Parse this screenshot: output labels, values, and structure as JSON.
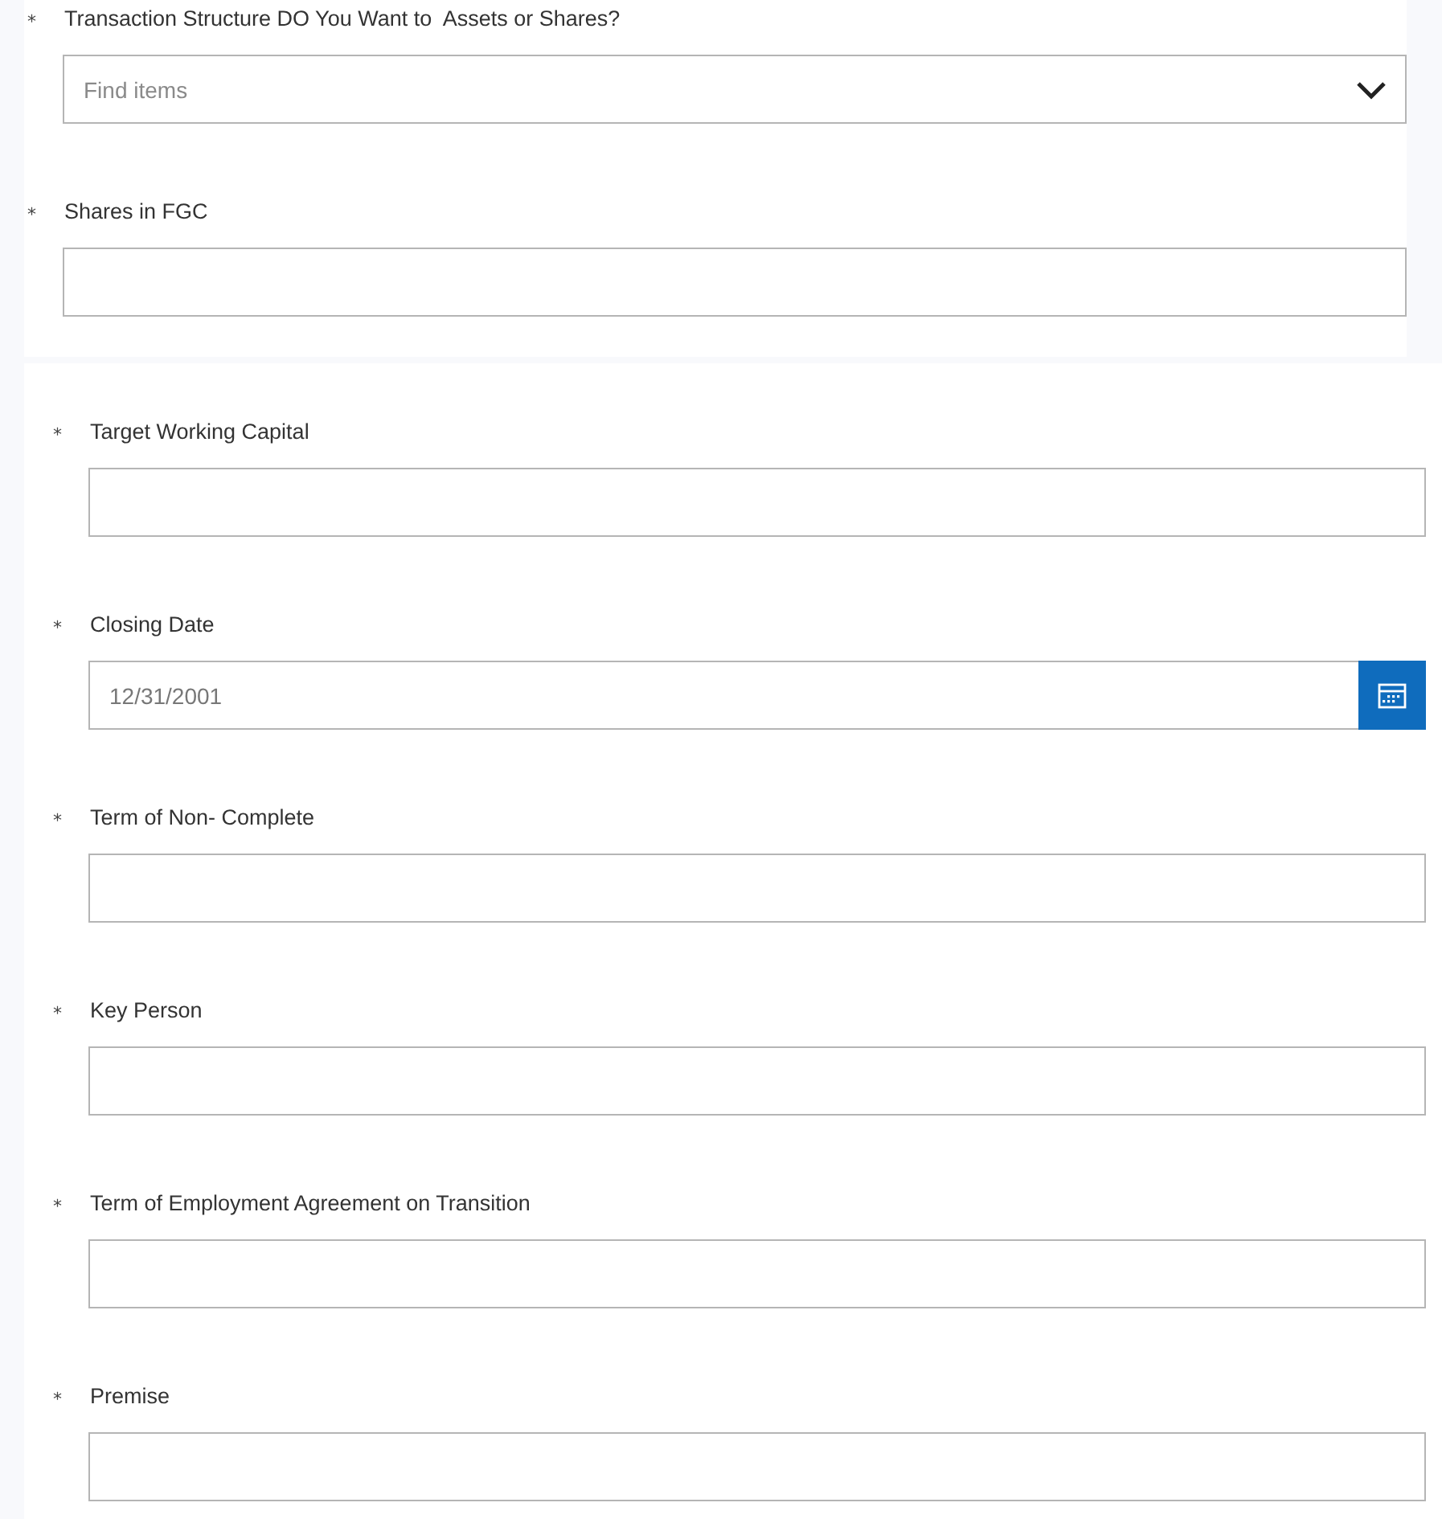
{
  "sections": [
    {
      "fields": [
        {
          "kind": "dropdown",
          "required_mark": "*",
          "label": "Transaction Structure DO You Want to  Assets or Shares?",
          "placeholder": "Find items"
        },
        {
          "kind": "text",
          "required_mark": "*",
          "label": "Shares in FGC"
        }
      ]
    },
    {
      "fields": [
        {
          "kind": "text",
          "required_mark": "*",
          "label": "Target Working Capital"
        },
        {
          "kind": "date",
          "required_mark": "*",
          "label": "Closing Date",
          "value": "12/31/2001"
        },
        {
          "kind": "text",
          "required_mark": "*",
          "label": "Term of Non- Complete"
        },
        {
          "kind": "text",
          "required_mark": "*",
          "label": "Key Person"
        },
        {
          "kind": "text",
          "required_mark": "*",
          "label": "Term of Employment Agreement on Transition"
        },
        {
          "kind": "text",
          "required_mark": "*",
          "label": "Premise"
        }
      ]
    }
  ]
}
